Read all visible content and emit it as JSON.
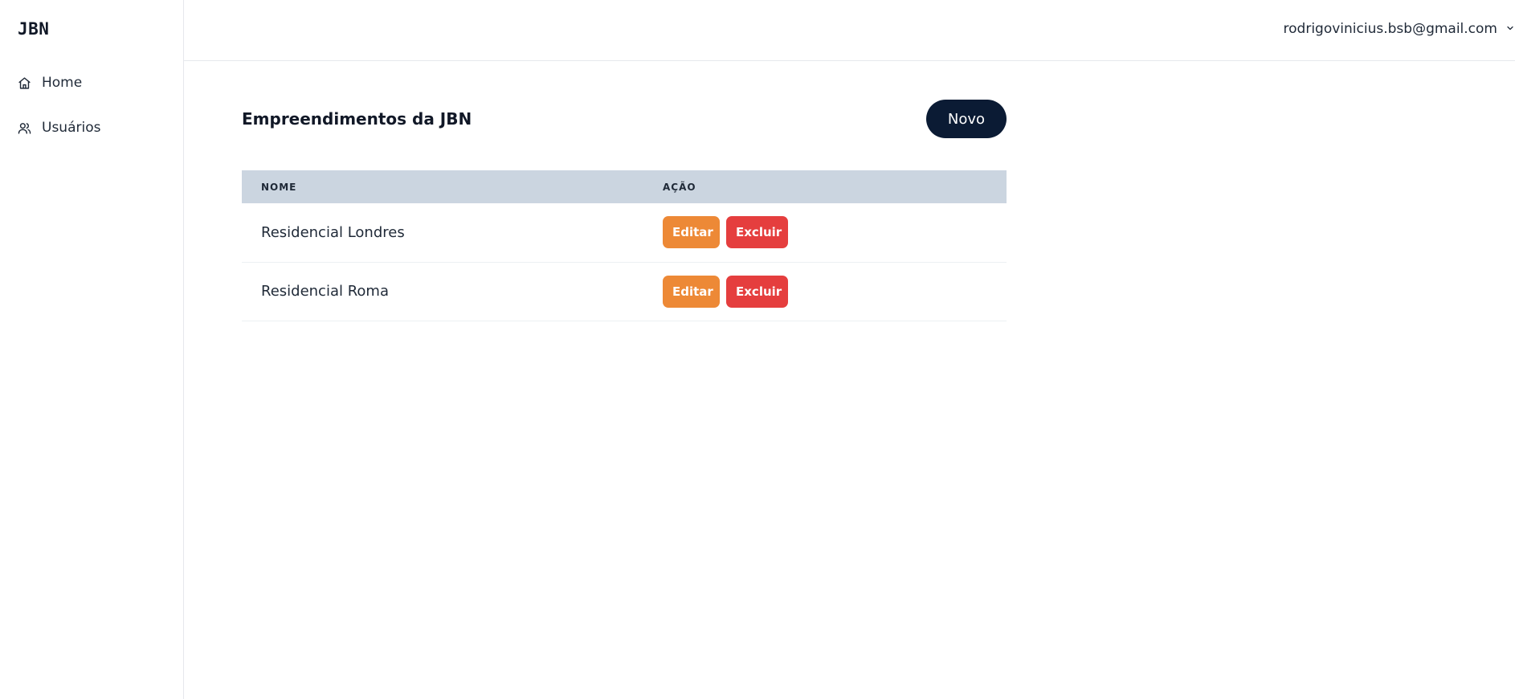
{
  "sidebar": {
    "brand": "JBN",
    "items": [
      {
        "label": "Home",
        "icon": "home-icon"
      },
      {
        "label": "Usuários",
        "icon": "users-icon"
      }
    ]
  },
  "header": {
    "user_email": "rodrigovinicius.bsb@gmail.com",
    "menu_icon": "chevron-down-icon"
  },
  "main": {
    "title": "Empreendimentos da JBN",
    "new_button": "Novo",
    "table": {
      "columns": [
        "NOME",
        "AÇÃO"
      ],
      "rows": [
        {
          "name": "Residencial Londres",
          "edit_label": "Editar",
          "delete_label": "Excluir"
        },
        {
          "name": "Residencial Roma",
          "edit_label": "Editar",
          "delete_label": "Excluir"
        }
      ]
    }
  },
  "colors": {
    "primary": "#0b1b34",
    "table_header": "#cbd5e0",
    "edit": "#ed8936",
    "delete": "#e53e3e"
  }
}
